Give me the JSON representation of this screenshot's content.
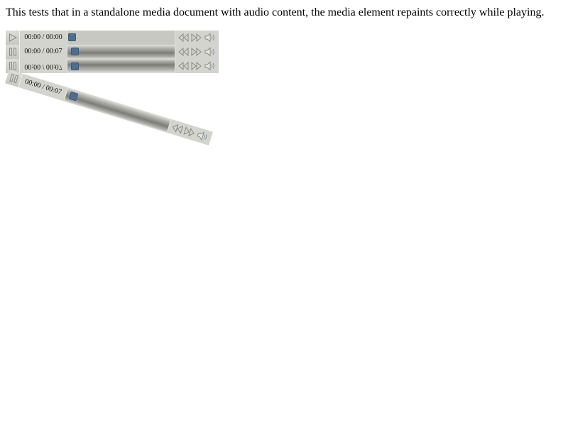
{
  "description": "This tests that in a standalone media document with audio content, the media element repaints correctly while playing.",
  "players": [
    {
      "state": "paused",
      "time_label": "00:00 / 00:00",
      "play_icon": "play-icon",
      "progress": 0.0
    },
    {
      "state": "playing",
      "time_label": "00:00 / 00:07",
      "play_icon": "pause-icon",
      "progress": 0.0
    },
    {
      "state": "playing",
      "time_label": "00:00 / 00:07",
      "transform": "flipped vertically",
      "play_icon": "pause-icon",
      "progress": 0.0
    },
    {
      "state": "playing",
      "time_label": "00:00 / 00:07",
      "transform": "rotated",
      "play_icon": "pause-icon",
      "progress": 0.0
    }
  ],
  "controls": {
    "rewind_icon": "rewind-icon",
    "forward_icon": "fast-forward-icon",
    "volume_icon": "volume-icon"
  },
  "colors": {
    "bar": "#d4d4cf",
    "thumb": "#4e6d8f",
    "icon": "#8a8a86"
  }
}
